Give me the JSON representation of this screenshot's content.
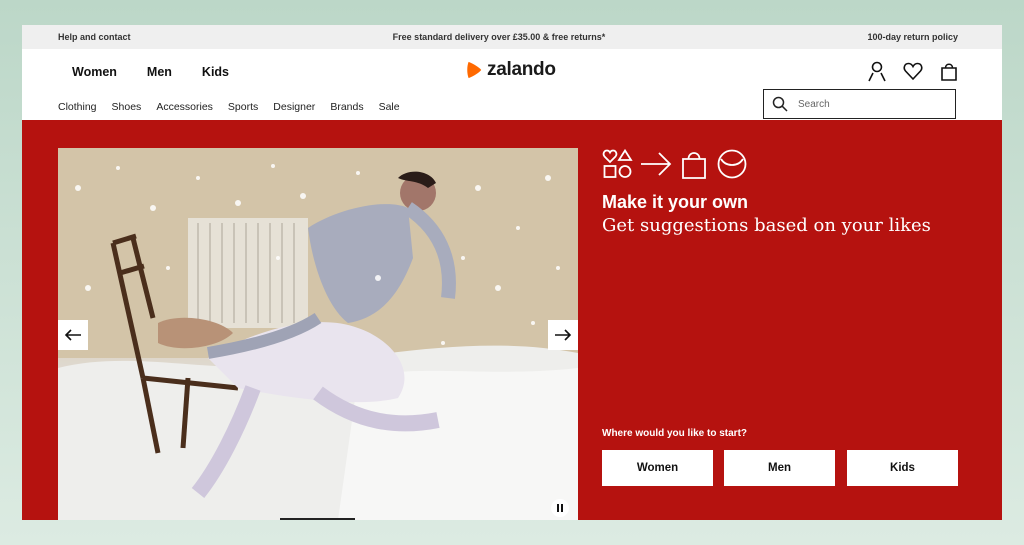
{
  "topbar": {
    "left": "Help and contact",
    "center": "Free standard delivery over £35.00 & free returns*",
    "right": "100-day return policy"
  },
  "header": {
    "gender_nav": [
      "Women",
      "Men",
      "Kids"
    ],
    "logo_text": "zalando",
    "icons": [
      "user-icon",
      "heart-icon",
      "bag-icon"
    ],
    "categories": [
      "Clothing",
      "Shoes",
      "Accessories",
      "Sports",
      "Designer",
      "Brands",
      "Sale"
    ],
    "search_placeholder": "Search"
  },
  "hero": {
    "icon_row": [
      "heart-shapes-icon",
      "arrow-right-icon",
      "shopping-bag-icon",
      "smile-icon"
    ],
    "title": "Make it your own",
    "subtitle": "Get suggestions based on your likes",
    "start_label": "Where would you like to start?",
    "buttons": [
      "Women",
      "Men",
      "Kids"
    ],
    "colors": {
      "background": "#b5120f",
      "text": "#ffffff"
    }
  },
  "colors": {
    "brand_orange": "#ff6900"
  }
}
